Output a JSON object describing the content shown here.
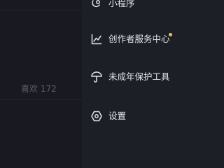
{
  "backdrop": {
    "likes_text": "喜欢 172"
  },
  "drawer": {
    "items": [
      {
        "label": "小程序",
        "icon": "mini-program-icon"
      },
      {
        "label": "创作者服务中心",
        "icon": "chart-line-icon",
        "badge_dot": true
      },
      {
        "label": "未成年保护工具",
        "icon": "umbrella-icon"
      },
      {
        "label": "设置",
        "icon": "settings-hexagon-icon"
      }
    ]
  },
  "colors": {
    "background": "#17181f",
    "drawer_bg": "#1d1f27",
    "text": "#e3e4e8",
    "muted_text": "#5d5e66",
    "badge_dot": "#f7c137"
  }
}
